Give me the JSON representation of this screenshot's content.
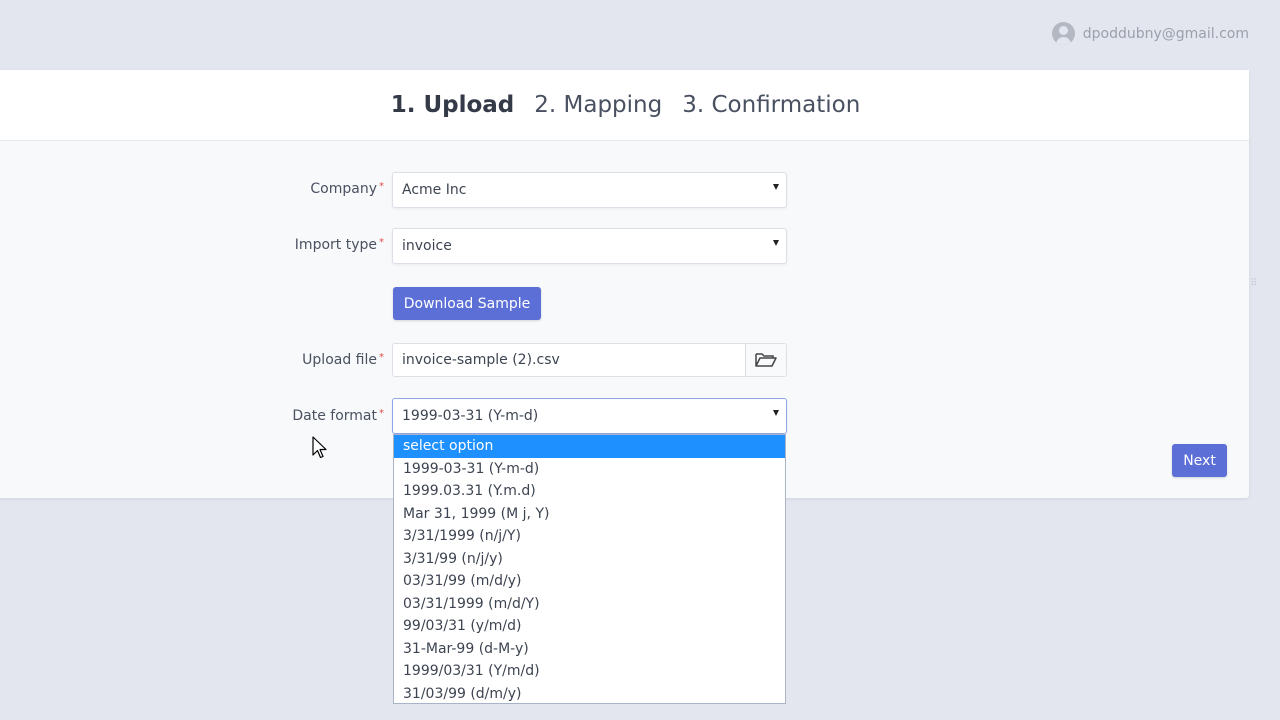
{
  "header": {
    "user_email": "dpoddubny@gmail.com"
  },
  "steps": [
    {
      "label": "1. Upload",
      "active": true
    },
    {
      "label": "2. Mapping",
      "active": false
    },
    {
      "label": "3. Confirmation",
      "active": false
    }
  ],
  "form": {
    "company": {
      "label": "Company",
      "value": "Acme Inc"
    },
    "import_type": {
      "label": "Import type",
      "value": "invoice"
    },
    "download_button": "Download Sample",
    "upload_file": {
      "label": "Upload file",
      "value": "invoice-sample (2).csv"
    },
    "date_format": {
      "label": "Date format",
      "value": "1999-03-31 (Y-m-d)",
      "options": [
        "select option",
        "1999-03-31 (Y-m-d)",
        "1999.03.31 (Y.m.d)",
        "Mar 31, 1999 (M j, Y)",
        "3/31/1999 (n/j/Y)",
        "3/31/99 (n/j/y)",
        "03/31/99 (m/d/y)",
        "03/31/1999 (m/d/Y)",
        "99/03/31 (y/m/d)",
        "31-Mar-99 (d-M-y)",
        "1999/03/31 (Y/m/d)",
        "31/03/99 (d/m/y)"
      ],
      "highlighted_option": "select option"
    },
    "required_mark": "*"
  },
  "next_button": "Next",
  "colors": {
    "primary": "#5c6fd6",
    "highlight": "#1e90ff",
    "required": "#e04b4b",
    "background": "#e3e6ef"
  },
  "icons": {
    "user": "user-avatar-icon",
    "browse": "folder-open-icon",
    "dropdown": "caret-down-icon",
    "cursor": "mouse-pointer-icon"
  }
}
